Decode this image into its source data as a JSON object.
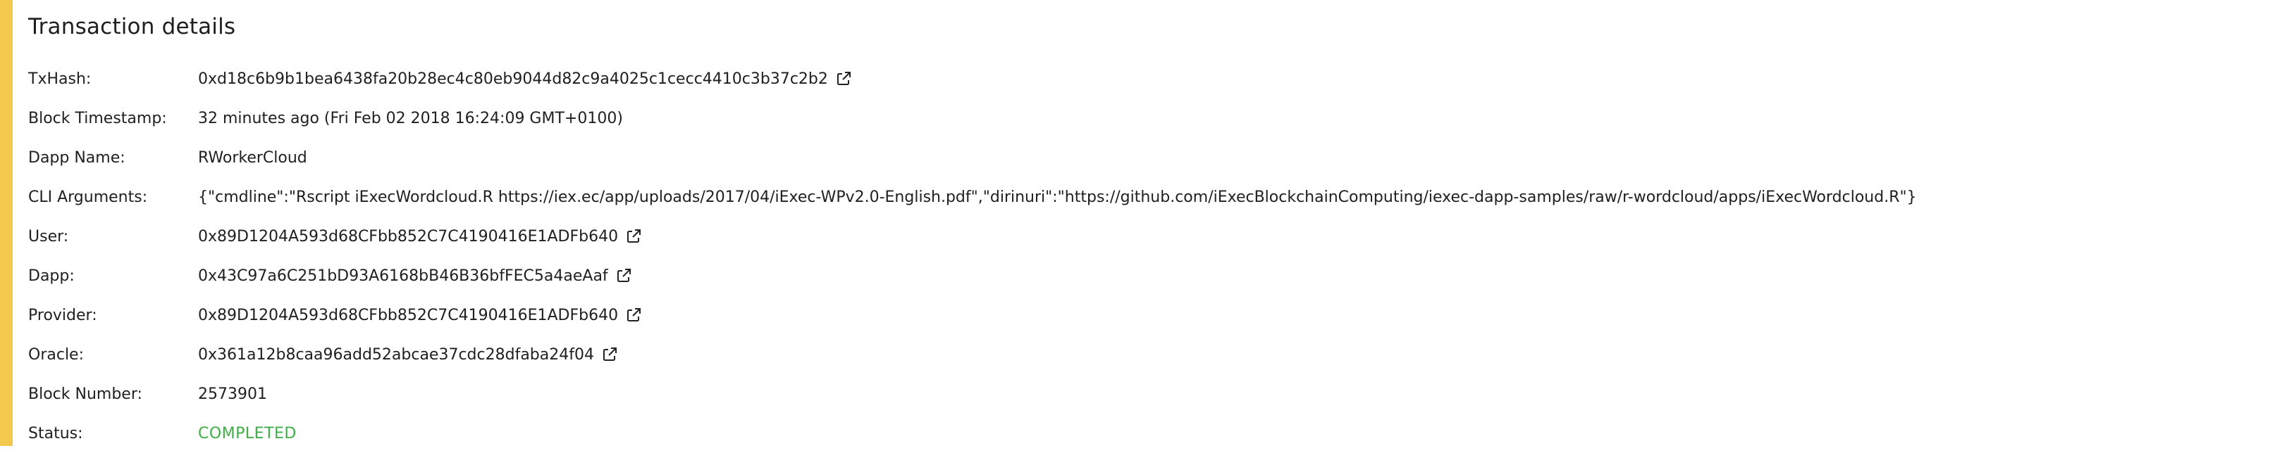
{
  "panel": {
    "title": "Transaction details",
    "accent_color": "#f2c94c"
  },
  "rows": [
    {
      "label": "TxHash:",
      "value": "0xd18c6b9b1bea6438fa20b28ec4c80eb9044d82c9a4025c1cecc4410c3b37c2b2",
      "icon": "external-link-icon"
    },
    {
      "label": "Block Timestamp:",
      "value": "32 minutes ago (Fri Feb 02 2018 16:24:09 GMT+0100)"
    },
    {
      "label": "Dapp Name:",
      "value": "RWorkerCloud"
    },
    {
      "label": "CLI Arguments:",
      "value": "{\"cmdline\":\"Rscript iExecWordcloud.R https://iex.ec/app/uploads/2017/04/iExec-WPv2.0-English.pdf\",\"dirinuri\":\"https://github.com/iExecBlockchainComputing/iexec-dapp-samples/raw/r-wordcloud/apps/iExecWordcloud.R\"}"
    },
    {
      "label": "User:",
      "value": "0x89D1204A593d68CFbb852C7C4190416E1ADFb640",
      "icon": "external-link-icon"
    },
    {
      "label": "Dapp:",
      "value": "0x43C97a6C251bD93A6168bB46B36bfFEC5a4aeAaf",
      "icon": "external-link-icon"
    },
    {
      "label": "Provider:",
      "value": "0x89D1204A593d68CFbb852C7C4190416E1ADFb640",
      "icon": "external-link-icon"
    },
    {
      "label": "Oracle:",
      "value": "0x361a12b8caa96add52abcae37cdc28dfaba24f04",
      "icon": "external-link-icon"
    },
    {
      "label": "Block Number:",
      "value": "2573901"
    },
    {
      "label": "Status:",
      "value": "COMPLETED",
      "status_color": "#3fae49"
    }
  ]
}
